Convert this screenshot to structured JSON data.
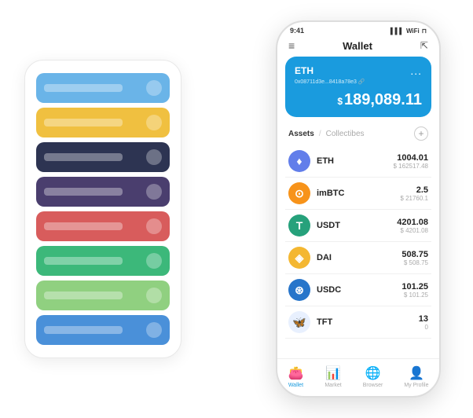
{
  "scene": {
    "card_stack": {
      "items": [
        {
          "color": "#6ab4e8",
          "label": "",
          "iconColor": "rgba(255,255,255,0.4)"
        },
        {
          "color": "#f0c040",
          "label": "",
          "iconColor": "rgba(255,255,255,0.4)"
        },
        {
          "color": "#2d3452",
          "label": "",
          "iconColor": "rgba(255,255,255,0.4)"
        },
        {
          "color": "#4a3e6e",
          "label": "",
          "iconColor": "rgba(255,255,255,0.4)"
        },
        {
          "color": "#d85c5c",
          "label": "",
          "iconColor": "rgba(255,255,255,0.4)"
        },
        {
          "color": "#3cb87a",
          "label": "",
          "iconColor": "rgba(255,255,255,0.4)"
        },
        {
          "color": "#90d080",
          "label": "",
          "iconColor": "rgba(255,255,255,0.4)"
        },
        {
          "color": "#4a90d9",
          "label": "",
          "iconColor": "rgba(255,255,255,0.4)"
        }
      ]
    },
    "phone": {
      "status_bar": {
        "time": "9:41",
        "signal": "▌▌▌",
        "wifi": "WiFi",
        "battery": "🔋"
      },
      "header": {
        "menu_icon": "≡",
        "title": "Wallet",
        "expand_icon": "⇱"
      },
      "wallet_card": {
        "token": "ETH",
        "address": "0x08711d3e...8418a78e3",
        "address_icon": "🔗",
        "dots": "...",
        "dollar_sign": "$",
        "balance": "189,089.11"
      },
      "assets_section": {
        "tab_active": "Assets",
        "divider": "/",
        "tab_inactive": "Collectibes",
        "add_icon": "+"
      },
      "tokens": [
        {
          "name": "ETH",
          "icon": "♦",
          "icon_bg": "#627EEA",
          "icon_color": "#fff",
          "amount": "1004.01",
          "usd": "$ 162517.48"
        },
        {
          "name": "imBTC",
          "icon": "⊙",
          "icon_bg": "#F7931A",
          "icon_color": "#fff",
          "amount": "2.5",
          "usd": "$ 21760.1"
        },
        {
          "name": "USDT",
          "icon": "T",
          "icon_bg": "#26A17B",
          "icon_color": "#fff",
          "amount": "4201.08",
          "usd": "$ 4201.08"
        },
        {
          "name": "DAI",
          "icon": "◈",
          "icon_bg": "#F4B731",
          "icon_color": "#fff",
          "amount": "508.75",
          "usd": "$ 508.75"
        },
        {
          "name": "USDC",
          "icon": "⊛",
          "icon_bg": "#2775CA",
          "icon_color": "#fff",
          "amount": "101.25",
          "usd": "$ 101.25"
        },
        {
          "name": "TFT",
          "icon": "🦋",
          "icon_bg": "#e8f0fe",
          "icon_color": "#4a90d9",
          "amount": "13",
          "usd": "0"
        }
      ],
      "bottom_nav": [
        {
          "icon": "👛",
          "label": "Wallet",
          "active": true
        },
        {
          "icon": "📊",
          "label": "Market",
          "active": false
        },
        {
          "icon": "🌐",
          "label": "Browser",
          "active": false
        },
        {
          "icon": "👤",
          "label": "My Profile",
          "active": false
        }
      ]
    }
  }
}
